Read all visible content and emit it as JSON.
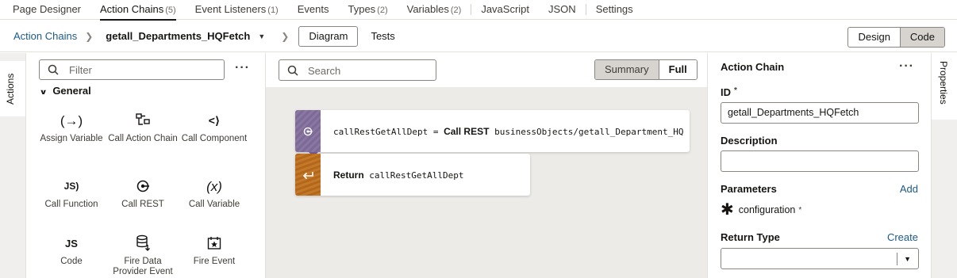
{
  "top_tabs": [
    {
      "label": "Page Designer",
      "count": ""
    },
    {
      "label": "Action Chains",
      "count": "(5)"
    },
    {
      "label": "Event Listeners",
      "count": "(1)"
    },
    {
      "label": "Events",
      "count": ""
    },
    {
      "label": "Types",
      "count": "(2)"
    },
    {
      "label": "Variables",
      "count": "(2)"
    },
    {
      "label": "JavaScript",
      "count": ""
    },
    {
      "label": "JSON",
      "count": ""
    },
    {
      "label": "Settings",
      "count": ""
    }
  ],
  "breadcrumb": {
    "root": "Action Chains",
    "current": "getall_Departments_HQFetch",
    "diagram_btn": "Diagram",
    "tests_btn": "Tests"
  },
  "view_toggle": {
    "design": "Design",
    "code": "Code"
  },
  "left_tab": "Actions",
  "palette": {
    "filter_placeholder": "Filter",
    "more": "···",
    "group": "General",
    "actions": [
      {
        "label": "Assign Variable",
        "icon": "assign-variable-icon"
      },
      {
        "label": "Call Action Chain",
        "icon": "call-action-chain-icon"
      },
      {
        "label": "Call Component",
        "icon": "call-component-icon"
      },
      {
        "label": "Call Function",
        "icon": "call-function-icon"
      },
      {
        "label": "Call REST",
        "icon": "call-rest-icon"
      },
      {
        "label": "Call Variable",
        "icon": "call-variable-icon"
      },
      {
        "label": "Code",
        "icon": "code-icon"
      },
      {
        "label": "Fire Data Provider Event",
        "icon": "fire-data-provider-event-icon"
      },
      {
        "label": "Fire Event",
        "icon": "fire-event-icon"
      }
    ]
  },
  "diagram": {
    "search_placeholder": "Search",
    "summary": "Summary",
    "full": "Full",
    "nodes": {
      "call_rest": {
        "var": "callRestGetAllDept",
        "eq": "=",
        "action": "Call REST",
        "endpoint": "businessObjects/getall_Department_HQ"
      },
      "return": {
        "keyword": "Return",
        "value": "callRestGetAllDept"
      }
    }
  },
  "properties": {
    "tab": "Properties",
    "title": "Action Chain",
    "more": "···",
    "id_label": "ID",
    "id_required": "*",
    "id_value": "getall_Departments_HQFetch",
    "description_label": "Description",
    "description_value": "",
    "parameters_label": "Parameters",
    "add_link": "Add",
    "param_name": "configuration",
    "param_required": "*",
    "return_type_label": "Return Type",
    "create_link": "Create",
    "return_type_value": ""
  },
  "colors": {
    "link": "#1b5a8a",
    "rest_node": "#7d6a96",
    "return_node": "#b4671a"
  }
}
